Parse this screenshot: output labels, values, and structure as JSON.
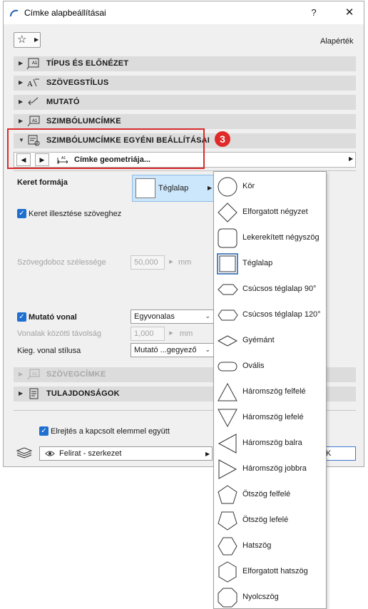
{
  "window": {
    "title": "Címke alapbeállításai",
    "help_label": "?",
    "close_label": "✕"
  },
  "header": {
    "favorites_icon": "star-icon",
    "defaults_label": "Alapérték"
  },
  "sections": [
    {
      "label": "TÍPUS ÉS ELŐNÉZET",
      "icon": "label-type-icon",
      "disabled": false
    },
    {
      "label": "SZÖVEGSTÍLUS",
      "icon": "text-style-icon",
      "disabled": false
    },
    {
      "label": "MUTATÓ",
      "icon": "pointer-icon",
      "disabled": false
    },
    {
      "label": "SZIMBÓLUMCÍMKE",
      "icon": "symbol-label-icon",
      "disabled": false
    },
    {
      "label": "SZIMBÓLUMCÍMKE EGYÉNI BEÁLLÍTÁSAI",
      "icon": "custom-settings-icon",
      "disabled": false
    },
    {
      "label": "SZÖVEGCÍMKE",
      "icon": "text-label-icon",
      "disabled": true
    },
    {
      "label": "TULAJDONSÁGOK",
      "icon": "properties-icon",
      "disabled": false
    }
  ],
  "callout_badge": "3",
  "pager": {
    "prev": "◀",
    "next": "▶",
    "page_label": "Címke geometriája..."
  },
  "form": {
    "frame_shape_label": "Keret formája",
    "frame_shape_value": "Téglalap",
    "fit_frame_label": "Keret illesztése szöveghez",
    "fit_frame_checked": true,
    "textbox_width_label": "Szövegdoboz szélessége",
    "textbox_width_value": "50,000",
    "textbox_width_unit": "mm",
    "leader_line_label": "Mutató vonal",
    "leader_line_checked": true,
    "leader_line_value": "Egyvonalas",
    "line_spacing_label": "Vonalak közötti távolság",
    "line_spacing_value": "1,000",
    "line_spacing_unit": "mm",
    "extra_line_style_label": "Kieg. vonal stílusa",
    "extra_line_style_value": "Mutató ...gegyező"
  },
  "footer": {
    "hide_with_element_label": "Elrejtés a kapcsolt elemmel együtt",
    "hide_with_element_checked": true,
    "layer_value": "Felirat - szerkezet",
    "ok_partial": "K"
  },
  "shape_menu": {
    "selected": "Téglalap",
    "items": [
      {
        "label": "Kör",
        "shape": "circle"
      },
      {
        "label": "Elforgatott négyzet",
        "shape": "rotated-square"
      },
      {
        "label": "Lekerekített négyszög",
        "shape": "rounded-rect"
      },
      {
        "label": "Téglalap",
        "shape": "rectangle"
      },
      {
        "label": "Csúcsos téglalap 90°",
        "shape": "pointed-rect-90"
      },
      {
        "label": "Csúcsos téglalap 120°",
        "shape": "pointed-rect-120"
      },
      {
        "label": "Gyémánt",
        "shape": "diamond"
      },
      {
        "label": "Ovális",
        "shape": "oval"
      },
      {
        "label": "Háromszög felfelé",
        "shape": "triangle-up"
      },
      {
        "label": "Háromszög lefelé",
        "shape": "triangle-down"
      },
      {
        "label": "Háromszög balra",
        "shape": "triangle-left"
      },
      {
        "label": "Háromszög jobbra",
        "shape": "triangle-right"
      },
      {
        "label": "Ötszög felfelé",
        "shape": "pentagon-up"
      },
      {
        "label": "Ötszög lefelé",
        "shape": "pentagon-down"
      },
      {
        "label": "Hatszög",
        "shape": "hexagon"
      },
      {
        "label": "Elforgatott hatszög",
        "shape": "rotated-hexagon"
      },
      {
        "label": "Nyolcszög",
        "shape": "octagon"
      }
    ]
  }
}
